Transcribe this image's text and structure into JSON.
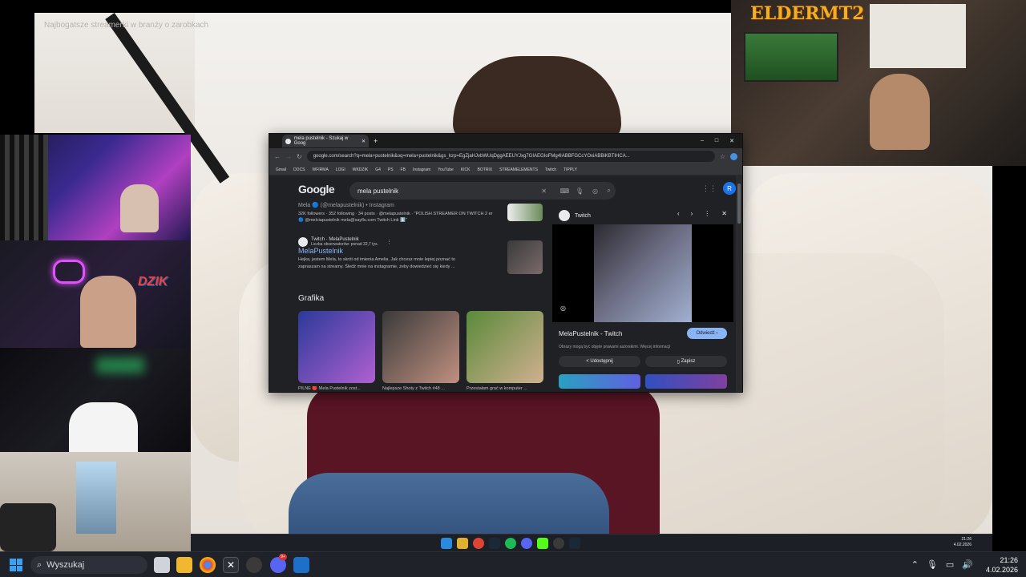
{
  "stream": {
    "overlay_title": "Najbogatsze streamerki w branży o zarobkach",
    "logo_text": "ELDERMT2",
    "cam_labels": {
      "dzik": "DZIK"
    }
  },
  "chrome": {
    "tab_title": "mela pustelnik - Szukaj w Goog",
    "new_tab": "+",
    "address": "google.com/search?q=mela+pustelnik&oq=mela+pustelnik&gs_lcrp=EgZjaHJvbWUqDggAEEUYJxg7GIAEGIoFMg4IABBFGCcYOxiABBiKBTIHCA...",
    "bookmarks": [
      "Gmail",
      "DOCS",
      "WFIRMA",
      "LOGI",
      "WKDZIK",
      "G4",
      "PS",
      "FB",
      "Instagram",
      "YouTube",
      "KICK",
      "BOTRIX",
      "STREAMELEMENTS",
      "Twitch",
      "TIPPLY"
    ],
    "window_controls": {
      "min": "–",
      "max": "□",
      "close": "✕"
    }
  },
  "google": {
    "logo": "Google",
    "query": "mela pustelnik",
    "avatar_letter": "R",
    "results": [
      {
        "site": "Mela 🔵 (@melapustelnik) • Instagram",
        "meta": "32K followers · 352 following · 34 posts · @melapustelnik · \"POLISH STREAMER ON TWITCH 2 er 🔵 @melciapustelnik mela@sayflu.com Twitch Link ⬇️\""
      },
      {
        "site": "Twitch · MelaPustelnik",
        "sub": "Liczba obserwatorów: ponad 32,7 tys.",
        "title": "MelaPustelnik",
        "snippet1": "Hejka, jestem Mela, to skrót od imienia Amelia. Jak chcesz mnie lepiej poznać to",
        "snippet2": "zapraszam na streamy. Śledź mnie na instagramie, żeby dowiedzieć się kiedy ..."
      }
    ],
    "images_heading": "Grafika",
    "images": [
      {
        "caption": "PILNE 🔴 Mela Pustelnik zost..."
      },
      {
        "caption": "Najlepsze Shoty z Twitch #48 ..."
      },
      {
        "caption": "Przestałam grać w komputer ..."
      }
    ],
    "panel": {
      "source": "Twitch",
      "title": "MelaPustelnik - Twitch",
      "visit": "Odwiedź",
      "note": "Obrazy mogą być objęte prawami autorskimi. Więcej informacji",
      "share": "Udostępnij",
      "save": "Zapisz"
    }
  },
  "inner_clock": {
    "time": "21:26",
    "date": "4.02.2026"
  },
  "taskbar": {
    "search_placeholder": "Wyszukaj",
    "time": "21:26",
    "date": "4.02.2026",
    "discord_badge": "9+"
  },
  "colors": {
    "accent": "#8ab4f8",
    "taskbar": "#1f2229",
    "page": "#202124"
  }
}
